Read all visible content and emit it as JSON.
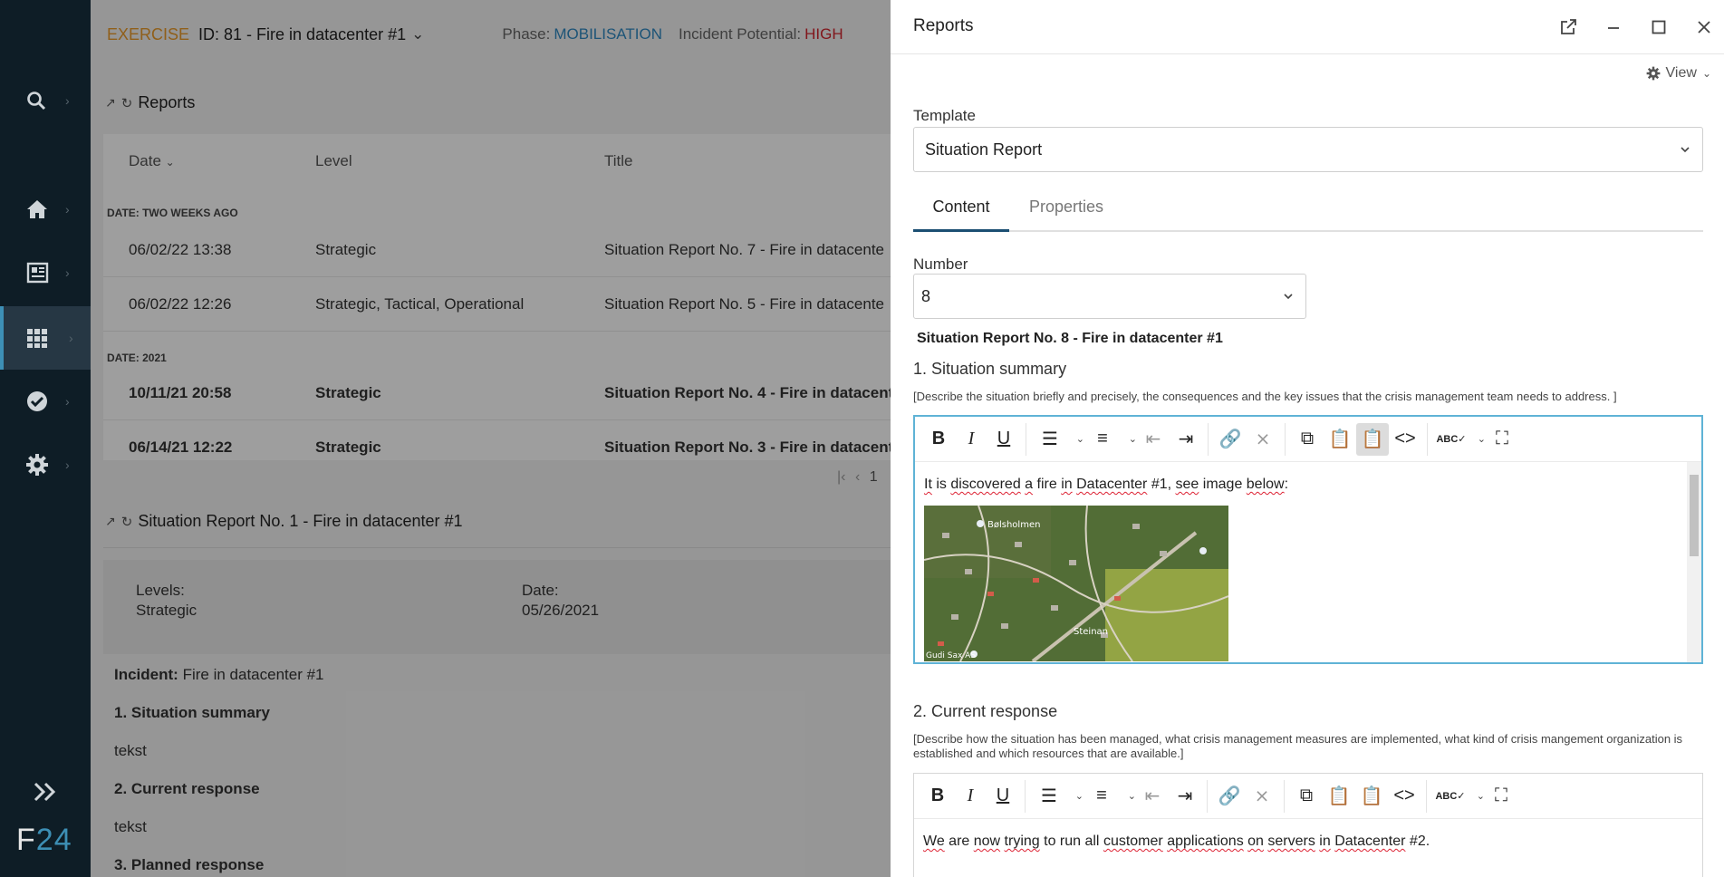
{
  "app": {
    "logo_letter": "F",
    "logo_number": "24"
  },
  "topbar": {
    "exercise_tag": "EXERCISE",
    "exercise_id": "ID: 81 - Fire in datacenter #1",
    "phase_label": "Phase:",
    "phase_value": "MOBILISATION",
    "potential_label": "Incident Potential:",
    "potential_value": "HIGH"
  },
  "reports_panel": {
    "title": "Reports",
    "columns": [
      "Date",
      "Level",
      "Title"
    ],
    "groups": [
      {
        "label": "DATE: TWO WEEKS AGO",
        "rows": [
          {
            "date": "06/02/22 13:38",
            "level": "Strategic",
            "title": "Situation Report No. 7 - Fire in datacente"
          },
          {
            "date": "06/02/22 12:26",
            "level": "Strategic, Tactical, Operational",
            "title": "Situation Report No. 5 - Fire in datacente"
          }
        ]
      },
      {
        "label": "DATE: 2021",
        "rows": [
          {
            "date": "10/11/21 20:58",
            "level": "Strategic",
            "title": "Situation Report No. 4 - Fire in datacente"
          },
          {
            "date": "06/14/21 12:22",
            "level": "Strategic",
            "title": "Situation Report No. 3 - Fire in datacente"
          }
        ]
      }
    ],
    "pager_page": "1"
  },
  "detail_panel": {
    "title": "Situation Report No. 1 - Fire in datacenter #1",
    "levels_label": "Levels:",
    "levels_value": "Strategic",
    "date_label": "Date:",
    "date_value": "05/26/2021",
    "incident_label": "Incident:",
    "incident_value": "Fire in datacenter #1",
    "s1_title": "1. Situation summary",
    "s1_text": "tekst",
    "s2_title": "2. Current response",
    "s2_text": "tekst",
    "s3_title": "3. Planned response"
  },
  "dialog": {
    "title": "Reports",
    "view_label": "View",
    "template_label": "Template",
    "template_value": "Situation Report",
    "tabs": [
      "Content",
      "Properties"
    ],
    "number_label": "Number",
    "number_value": "8",
    "report_header": "Situation Report  No.  8 - Fire in datacenter #1",
    "section1_title": "1. Situation summary",
    "section1_hint": "[Describe the situation briefly and precisely, the consequences and the key issues that the crisis management team needs to address. ]",
    "section1_words": [
      "It",
      " is ",
      "discovered",
      " ",
      "a",
      " fire ",
      "in",
      " ",
      "Datacenter",
      " #1, ",
      "see",
      " image ",
      "below",
      ":"
    ],
    "map_labels": [
      "Bølsholmen",
      "Steinan",
      "Gudi Sax AS"
    ],
    "section2_title": "2. Current response",
    "section2_hint": "[Describe how the situation has been managed, what crisis management measures are implemented, what kind of crisis mangement organization is established and which resources that are available.]",
    "section2_words": [
      "We",
      " are ",
      "now",
      " ",
      "trying",
      " to run all ",
      "customer",
      " ",
      "applications",
      " ",
      "on",
      " ",
      "servers",
      " ",
      "in",
      " ",
      "Datacenter",
      " #2."
    ]
  },
  "colors": {
    "accent": "#2f88c0",
    "warning": "#d0252e",
    "exercise": "#e89a2a",
    "sidebar": "#0e1d26"
  }
}
